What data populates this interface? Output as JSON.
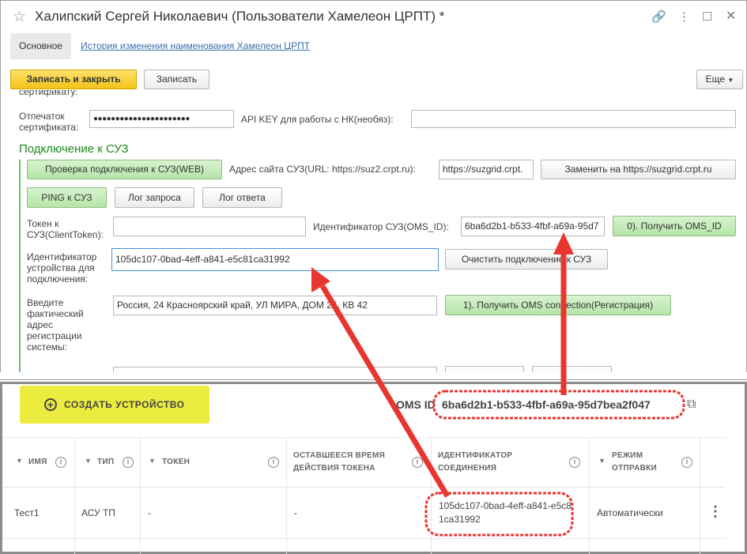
{
  "window": {
    "title": "Халипский Сергей Николаевич (Пользователи Хамелеон ЦРПТ) *",
    "tabs": [
      {
        "label": "Основное"
      },
      {
        "label": "История изменения наименования Хамелеон ЦРПТ"
      }
    ]
  },
  "toolbar": {
    "save_close": "Записать и закрыть",
    "save": "Записать",
    "more": "Еще"
  },
  "form": {
    "cut_label": "сертификату:",
    "thumbprint_label": "Отпечаток сертификата:",
    "thumbprint_value": "●●●●●●●●●●●●●●●●●●●●●●",
    "apikey_label": "API KEY для работы с НК(необяз):",
    "apikey_value": "",
    "section_title": "Подключение к СУЗ",
    "check_btn": "Проверка подключения к СУЗ(WEB)",
    "site_label": "Адрес сайта СУЗ(URL: https://suz2.crpt.ru):",
    "site_value": "https://suzgrid.crpt.",
    "replace_btn": "Заменить на https://suzgrid.crpt.ru",
    "ping_btn": "PING к СУЗ",
    "req_log_btn": "Лог запроса",
    "resp_log_btn": "Лог ответа",
    "token_label": "Токен к СУЗ(ClientToken):",
    "token_value": "",
    "oms_label": "Идентификатор СУЗ(OMS_ID):",
    "oms_value": "6ba6d2b1-b533-4fbf-a69a-95d7",
    "get_oms_btn": "0). Получить OMS_ID",
    "device_label": "Идентификатор устройства для подключения:",
    "device_value": "105dc107-0bad-4eff-a841-e5c81ca31992",
    "clear_btn": "Очистить подключение к СУЗ",
    "address_label": "Введите фактический адрес регистрации системы:",
    "address_value": "Россия, 24 Красноярский край, УЛ МИРА, ДОМ 25, КВ 42",
    "get_conn_btn": "1). Получить OMS connection(Регистрация)"
  },
  "suz": {
    "create_btn": "СОЗДАТЬ УСТРОЙСТВО",
    "oms_id_label": "OMS ID",
    "oms_id_value": "6ba6d2b1-b533-4fbf-a69a-95d7bea2f047",
    "columns": [
      "ИМЯ",
      "ТИП",
      "ТОКЕН",
      "ОСТАВШЕЕСЯ ВРЕМЯ ДЕЙСТВИЯ ТОКЕНА",
      "ИДЕНТИФИКАТОР СОЕДИНЕНИЯ",
      "РЕЖИМ ОТПРАВКИ"
    ],
    "row": {
      "name": "Тест1",
      "type": "АСУ ТП",
      "token": "-",
      "remaining": "-",
      "connection_id": "105dc107-0bad-4eff-a841-e5c81ca31992",
      "mode": "Автоматически"
    }
  },
  "colors": {
    "annotation": "#e8362f",
    "section": "#1b8a1b",
    "create": "#ecec40"
  }
}
